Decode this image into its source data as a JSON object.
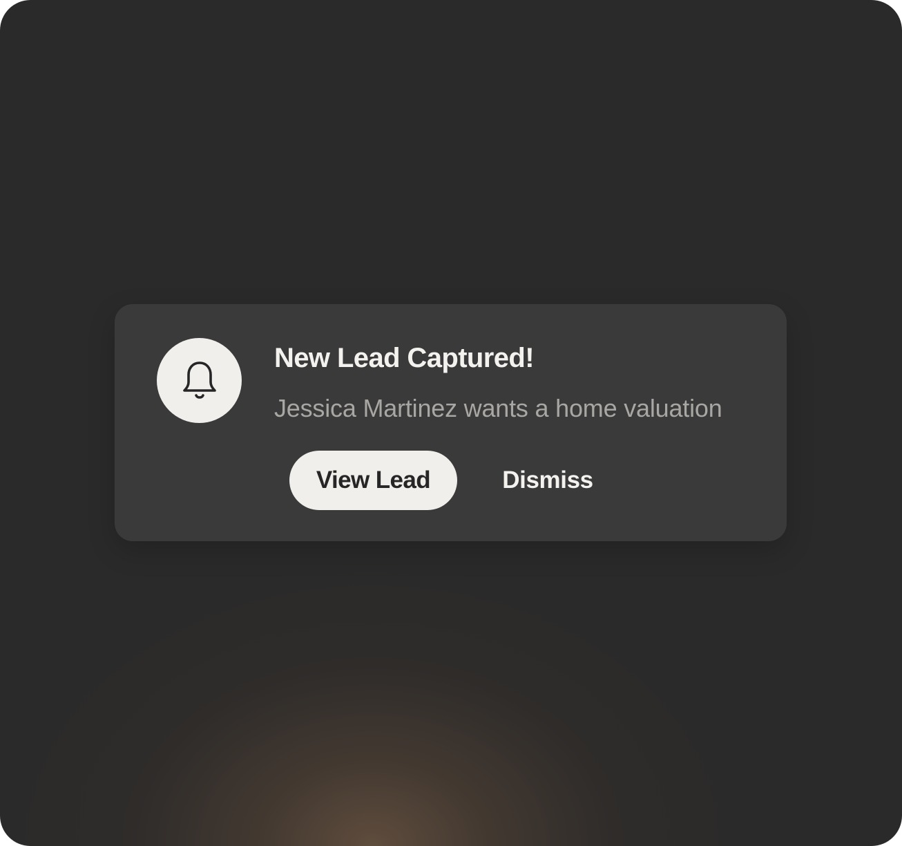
{
  "notification": {
    "icon": "bell-icon",
    "title": "New Lead Captured!",
    "message": "Jessica Martinez wants a home valuation",
    "actions": {
      "primary_label": "View Lead",
      "secondary_label": "Dismiss"
    }
  },
  "colors": {
    "background": "#2a2a2a",
    "card": "#3a3a3a",
    "icon_circle": "#f1efec",
    "primary_button": "#f1efec",
    "title_text": "#f4f2ef",
    "message_text": "#a9a7a4",
    "glow": "#6e5642"
  }
}
